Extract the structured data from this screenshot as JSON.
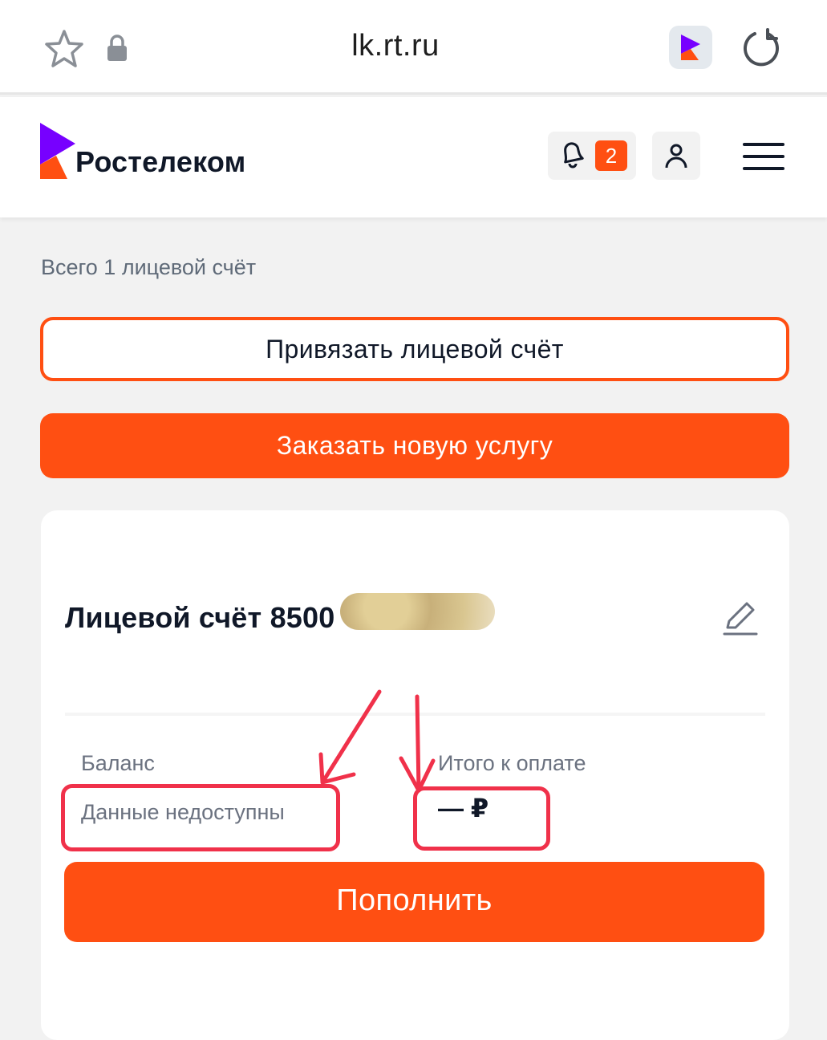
{
  "browser": {
    "url": "lk.rt.ru"
  },
  "header": {
    "brand_name": "Ростелеком",
    "notifications_count": "2"
  },
  "accounts": {
    "summary": "Всего 1 лицевой счёт",
    "link_account_label": "Привязать лицевой счёт",
    "order_service_label": "Заказать новую услугу"
  },
  "account_card": {
    "title": "Лицевой счёт 8500",
    "balance_label": "Баланс",
    "balance_value": "Данные недоступны",
    "total_label": "Итого к оплате",
    "total_value": "— ₽",
    "topup_label": "Пополнить"
  },
  "colors": {
    "accent": "#ff4f12",
    "brand_purple": "#7700ff",
    "annotation": "#f0314a"
  },
  "icons": {
    "star": "star-icon",
    "lock": "lock-icon",
    "reload": "reload-icon",
    "bell": "bell-icon",
    "profile": "profile-icon",
    "menu": "menu-icon",
    "edit": "edit-icon"
  }
}
